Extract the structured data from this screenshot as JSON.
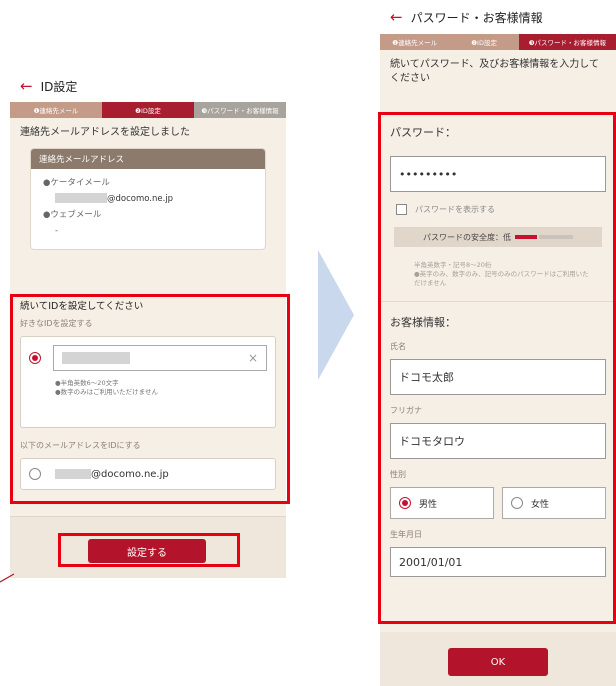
{
  "steps": [
    "❶連絡先メール",
    "❷ID設定",
    "❸パスワード・お客様情報"
  ],
  "left": {
    "title": "ID設定",
    "message": "連絡先メールアドレスを設定しました",
    "card_header": "連絡先メールアドレス",
    "carrier_label": "●ケータイメール",
    "carrier_email": "@docomo.ne.jp",
    "web_label": "●ウェブメール",
    "web_value": "-",
    "id_heading": "続いてIDを設定してください",
    "free_id_label": "好きなIDを設定する",
    "id_note_1": "●半角英数6～20文字",
    "id_note_2": "●数字のみはご利用いただけません",
    "use_email_label": "以下のメールアドレスをIDにする",
    "use_email_value": "@docomo.ne.jp",
    "submit": "設定する"
  },
  "right": {
    "title": "パスワード・お客様情報",
    "message": "続いてパスワード、及びお客様情報を入力してください",
    "password_heading": "パスワード：",
    "password_value": "•••••••••",
    "show_password": "パスワードを表示する",
    "strength_label": "パスワードの安全度：低",
    "rule_1": "半角英数字・記号8～20桁",
    "rule_2": "●英字のみ、数字のみ、記号のみのパスワードはご利用いただけません",
    "customer_heading": "お客様情報：",
    "name_label": "氏名",
    "name_value": "ドコモ太郎",
    "kana_label": "フリガナ",
    "kana_value": "ドコモタロウ",
    "gender_label": "性別",
    "male": "男性",
    "female": "女性",
    "dob_label": "生年月日",
    "dob_value": "2001/01/01",
    "ok": "OK"
  },
  "colors": {
    "accent": "#c8102e",
    "highlight": "#e60012",
    "arrow": "#c9d8ec"
  }
}
